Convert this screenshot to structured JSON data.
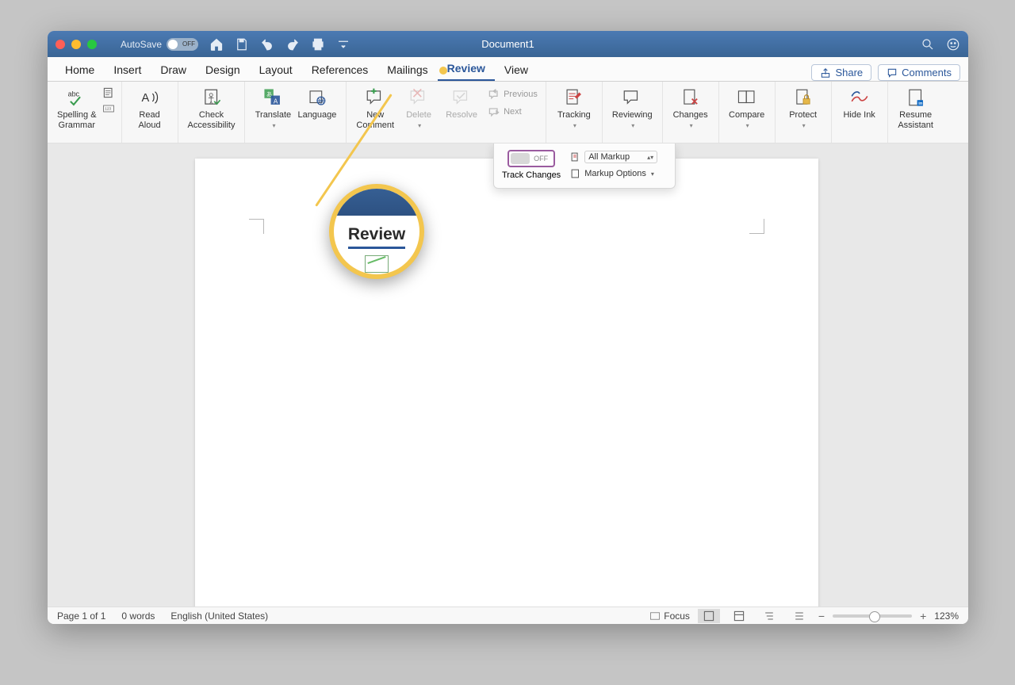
{
  "title_bar": {
    "autosave_label": "AutoSave",
    "autosave_state": "OFF",
    "document_title": "Document1"
  },
  "tabs": {
    "items": [
      "Home",
      "Insert",
      "Draw",
      "Design",
      "Layout",
      "References",
      "Mailings",
      "Review",
      "View"
    ],
    "active": "Review",
    "share_label": "Share",
    "comments_label": "Comments"
  },
  "ribbon": {
    "spelling": "Spelling &\nGrammar",
    "read_aloud": "Read\nAloud",
    "accessibility": "Check\nAccessibility",
    "translate": "Translate",
    "language": "Language",
    "new_comment": "New\nComment",
    "delete": "Delete",
    "resolve": "Resolve",
    "previous": "Previous",
    "next": "Next",
    "tracking": "Tracking",
    "reviewing": "Reviewing",
    "changes": "Changes",
    "compare": "Compare",
    "protect": "Protect",
    "hide_ink": "Hide Ink",
    "resume": "Resume\nAssistant"
  },
  "popup": {
    "track_changes": "Track Changes",
    "toggle_state": "OFF",
    "markup_select": "All Markup",
    "markup_options": "Markup Options"
  },
  "callout": {
    "label": "Review"
  },
  "status": {
    "page": "Page 1 of 1",
    "words": "0 words",
    "lang": "English (United States)",
    "focus": "Focus",
    "zoom": "123%"
  }
}
